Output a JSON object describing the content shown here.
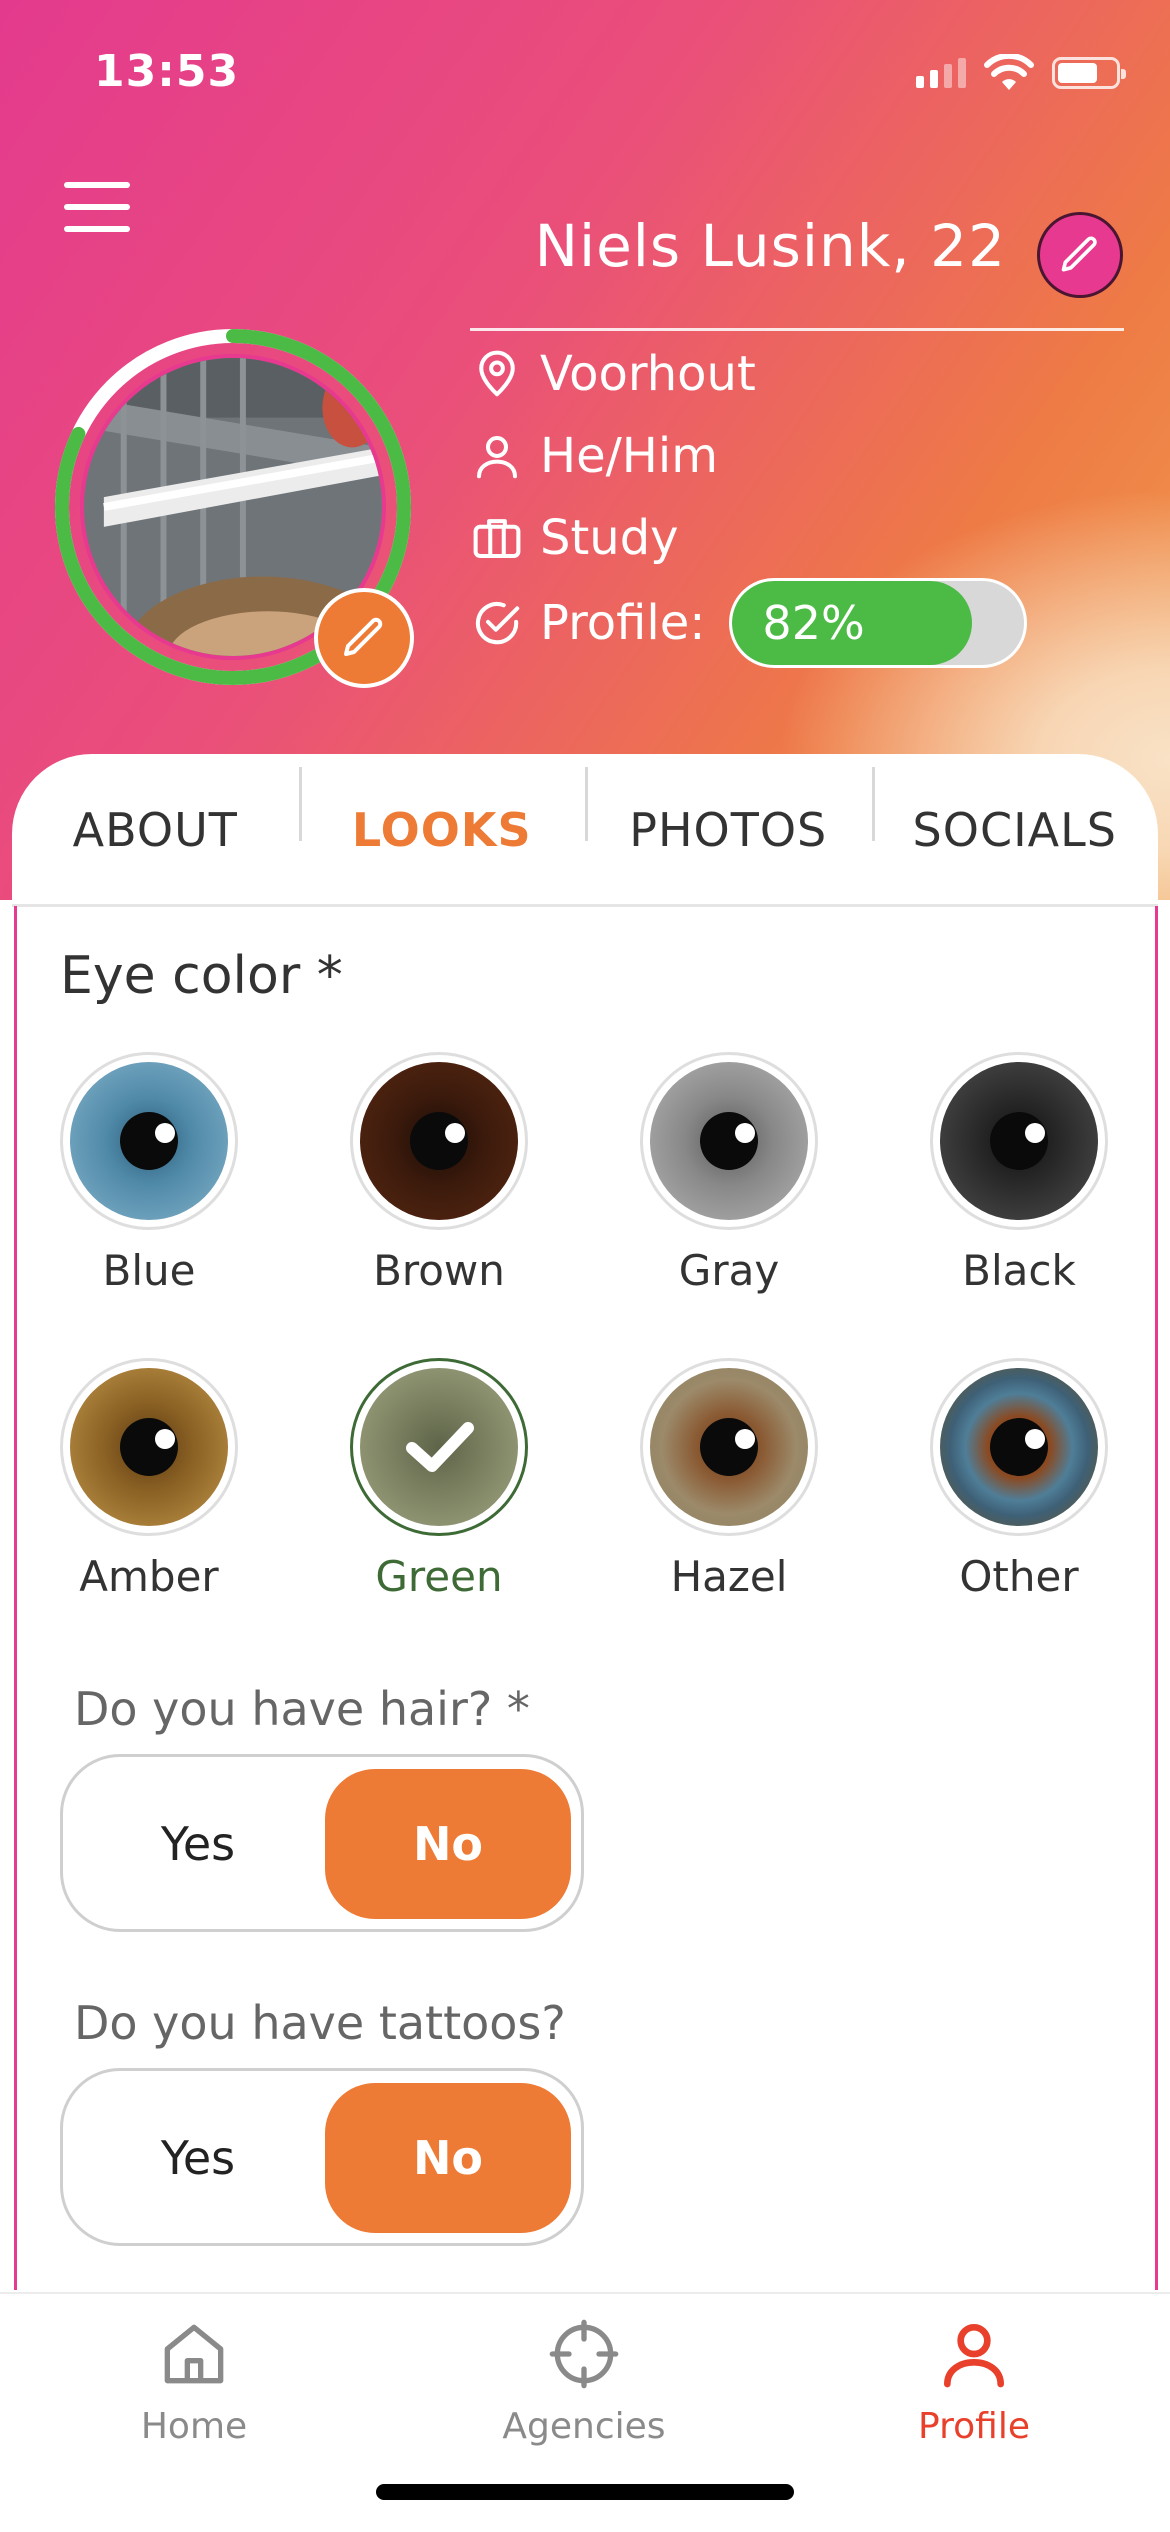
{
  "status_bar": {
    "time": "13:53"
  },
  "profile": {
    "name": "Niels Lusink, 22",
    "location": "Voorhout",
    "pronouns": "He/Him",
    "occupation": "Study",
    "completion_label": "Profile:",
    "completion_text": "82%",
    "completion_fraction": 0.82
  },
  "tabs": [
    {
      "label": "ABOUT"
    },
    {
      "label": "LOOKS"
    },
    {
      "label": "PHOTOS"
    },
    {
      "label": "SOCIALS"
    }
  ],
  "looks": {
    "eye_color_title": "Eye color *",
    "eye_colors": [
      {
        "label": "Blue"
      },
      {
        "label": "Brown"
      },
      {
        "label": "Gray"
      },
      {
        "label": "Black"
      },
      {
        "label": "Amber"
      },
      {
        "label": "Green"
      },
      {
        "label": "Hazel"
      },
      {
        "label": "Other"
      }
    ],
    "selected_eye_color": "Green",
    "hair_question": "Do you have hair? *",
    "hair_yes": "Yes",
    "hair_no": "No",
    "hair_selected": "No",
    "tattoo_question": "Do you have tattoos?",
    "tattoo_yes": "Yes",
    "tattoo_no": "No",
    "tattoo_selected": "No"
  },
  "nav": {
    "home": "Home",
    "agencies": "Agencies",
    "profile": "Profile",
    "active": "Profile"
  },
  "colors": {
    "accent_orange": "#ee7b35",
    "accent_pink": "#e6398f",
    "progress_green": "#4cbb46",
    "selected_green": "#3d6a35",
    "nav_active": "#e8402a"
  }
}
